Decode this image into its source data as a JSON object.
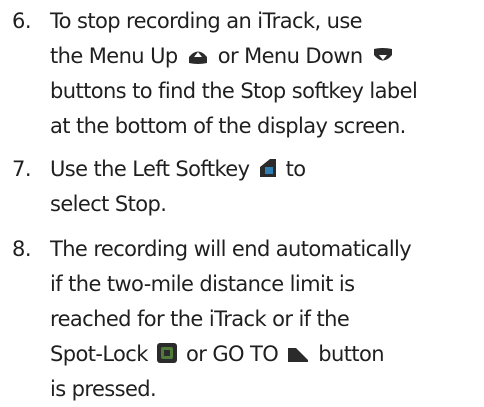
{
  "steps": [
    {
      "number": "6.",
      "line1": "To stop recording an iTrack, use",
      "line2_a": "the Menu Up",
      "line2_b": "or Menu Down",
      "line3": "buttons to find the Stop softkey label",
      "line4": "at the bottom of the display screen.",
      "icons": [
        "menu-up-icon",
        "menu-down-icon"
      ]
    },
    {
      "number": "7.",
      "line1_a": "Use the Left Softkey",
      "line1_b": "to",
      "line2": "select Stop.",
      "icons": [
        "left-softkey-icon"
      ]
    },
    {
      "number": "8.",
      "line1": "The recording will end automatically",
      "line2": "if the two-mile distance limit is",
      "line3": "reached for the iTrack or if the",
      "line4_a": "Spot-Lock",
      "line4_b": "or GO TO",
      "line4_c": "button",
      "line5": "is pressed.",
      "icons": [
        "spot-lock-icon",
        "go-to-icon"
      ]
    }
  ],
  "colors": {
    "text": "#1f1f1f",
    "icon_dark": "#2b2b2b",
    "icon_accent": "#2f7fb5",
    "spot_lock_accent": "#4f7a3a"
  }
}
